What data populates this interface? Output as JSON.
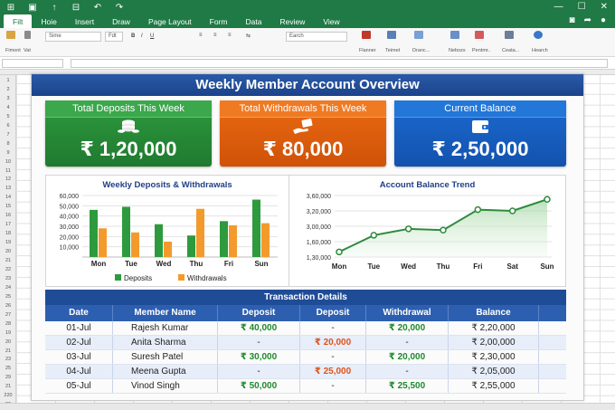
{
  "tabs": [
    "Filt",
    "Hoie",
    "Insert",
    "Draw",
    "Page Layout",
    "Form",
    "Data",
    "Review",
    "View"
  ],
  "ribbon": {
    "labels": [
      "Fimont",
      "Vat",
      "Flanner",
      "Teimet",
      "Dranc...",
      "Nebozs",
      "Pentmr..",
      "Ceata...",
      "Hearch"
    ],
    "font_name": "Sime",
    "font_size": "Fdt",
    "number_format": "Earch"
  },
  "row_numbers": [
    "1",
    "2",
    "3",
    "4",
    "5",
    "6",
    "7",
    "8",
    "9",
    "10",
    "11",
    "12",
    "13",
    "14",
    "15",
    "16",
    "17",
    "18",
    "19",
    "20",
    "21",
    "22",
    "23",
    "24",
    "25",
    "26",
    "27",
    "28",
    "19",
    "20",
    "21",
    "23",
    "25",
    "29",
    "21",
    "220",
    "20"
  ],
  "dashboard": {
    "title": "Weekly Member Account Overview",
    "cards": {
      "deposits": {
        "label": "Total Deposits This Week",
        "value": "₹ 1,20,000"
      },
      "withdrawals": {
        "label": "Total Withdrawals This Week",
        "value": "₹ 80,000"
      },
      "balance": {
        "label": "Current Balance",
        "value": "₹ 2,50,000"
      }
    }
  },
  "chart_data": [
    {
      "type": "bar",
      "title": "Weekly Deposits & Withdrawals",
      "categories": [
        "Mon",
        "Tue",
        "Wed",
        "Thu",
        "Fri",
        "Sun"
      ],
      "series": [
        {
          "name": "Deposits",
          "values": [
            46000,
            49000,
            32000,
            21000,
            35000,
            56000
          ],
          "color": "#2e9a3e"
        },
        {
          "name": "Withdrawals",
          "values": [
            28000,
            24000,
            15000,
            47000,
            31000,
            33000
          ],
          "color": "#f39a2c"
        }
      ],
      "yticks": [
        "60,000",
        "50,000",
        "40,000",
        "30,000",
        "20,000",
        "10,000"
      ],
      "ylim": [
        0,
        60000
      ],
      "legend": "bottom"
    },
    {
      "type": "area",
      "title": "Account Balance Trend",
      "categories": [
        "Mon",
        "Tue",
        "Wed",
        "Thu",
        "Fri",
        "Sat",
        "Sun"
      ],
      "values": [
        140000,
        205000,
        230000,
        225000,
        305000,
        300000,
        345000
      ],
      "yticks": [
        "3,60,000",
        "3,20,000",
        "3,00,000",
        "1,60,000",
        "1,30,000"
      ],
      "ytick_values": [
        360000,
        300000,
        240000,
        180000,
        120000
      ],
      "ylim": [
        120000,
        360000
      ],
      "color": "#2e8b3e"
    }
  ],
  "table": {
    "title": "Transaction Details",
    "headers": [
      "Date",
      "Member Name",
      "Deposit",
      "Deposit",
      "Withdrawal",
      "Balance",
      ""
    ],
    "rows": [
      {
        "date": "01-Jul",
        "name": "Rajesh Kumar",
        "deposit": "₹ 40,000",
        "deposit2": "-",
        "withdrawal": "₹ 20,000",
        "balance": "₹ 2,20,000"
      },
      {
        "date": "02-Jul",
        "name": "Anita Sharma",
        "deposit": "-",
        "deposit2": "₹ 20,000",
        "withdrawal": "-",
        "balance": "₹ 2,00,000"
      },
      {
        "date": "03-Jul",
        "name": "Suresh Patel",
        "deposit": "₹ 30,000",
        "deposit2": "-",
        "withdrawal": "₹ 20,000",
        "balance": "₹ 2,30,000"
      },
      {
        "date": "04-Jul",
        "name": "Meena Gupta",
        "deposit": "-",
        "deposit2": "₹ 25,000",
        "withdrawal": "-",
        "balance": "₹ 2,05,000"
      },
      {
        "date": "05-Jul",
        "name": "Vinod Singh",
        "deposit": "₹ 50,000",
        "deposit2": "-",
        "withdrawal": "₹ 25,500",
        "balance": "₹ 2,55,000"
      }
    ]
  },
  "colors": {
    "green": "#2e9a3e",
    "orange": "#ea6a12",
    "blue": "#1b6ad0",
    "header": "#1f4c96",
    "ribbon": "#1f7a45"
  }
}
